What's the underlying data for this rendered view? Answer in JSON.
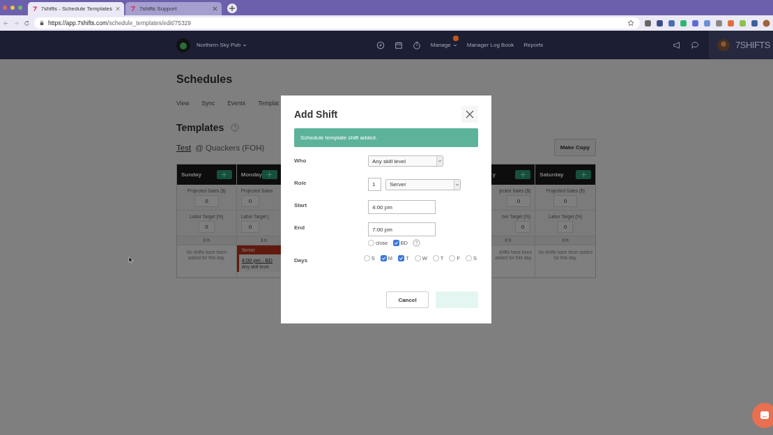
{
  "browser": {
    "tabs": [
      {
        "title": "7shifts - Schedule Templates",
        "selected": true
      },
      {
        "title": "7shifts Support",
        "selected": false
      }
    ],
    "url_host": "https://app.7shifts.com",
    "url_path": "/schedule_templates/edit/75329"
  },
  "nav": {
    "location": "Northern Sky Pub",
    "manage": "Manage",
    "links": [
      "Manager Log Book",
      "Reports"
    ],
    "brand": "7SHIFTS"
  },
  "page": {
    "title": "Schedules",
    "tabs": [
      "View",
      "Sync",
      "Events",
      "Templat"
    ],
    "section": "Templates",
    "template_name": "Test",
    "template_location": "@ Quackers (FOH)",
    "copy_button": "Make Copy"
  },
  "days": [
    {
      "name": "Sunday",
      "projected_label": "Projected Sales ($)",
      "projected": "0",
      "labor_label": "Labor Target (%)",
      "labor": "0",
      "hours": "0 h",
      "empty_text": "No shifts have been added for this day."
    },
    {
      "name": "Monday",
      "projected_label": "Projected Sales",
      "projected": "0",
      "labor_label": "Labor Target (",
      "labor": "0",
      "hours": "3 h",
      "shift": {
        "role": "Server",
        "time": "4:00 pm - BD",
        "skill": "Any skill level"
      }
    },
    {
      "name": "y",
      "projected_label": "jected Sales ($)",
      "projected": "0",
      "labor_label": "bor Target (%)",
      "labor": "0",
      "hours": "0 h",
      "empty_text": "shifts have been added for this day."
    },
    {
      "name": "Saturday",
      "projected_label": "Projected Sales ($)",
      "projected": "0",
      "labor_label": "Labor Target (%)",
      "labor": "0",
      "hours": "0 h",
      "empty_text": "No shifts have been added for this day."
    }
  ],
  "modal": {
    "title": "Add Shift",
    "alert": "Schedule template shift added.",
    "who_label": "Who",
    "who": "Any skill level",
    "role_label": "Role",
    "role_count": "1",
    "role": "Server",
    "start_label": "Start",
    "start": "4:00 pm",
    "end_label": "End",
    "end": "7:00 pm",
    "end_options": [
      {
        "label": "close",
        "checked": false
      },
      {
        "label": "BD",
        "checked": true
      }
    ],
    "days_label": "Days",
    "days": [
      {
        "label": "S",
        "checked": false
      },
      {
        "label": "M",
        "checked": true
      },
      {
        "label": "T",
        "checked": true
      },
      {
        "label": "W",
        "checked": false
      },
      {
        "label": "T",
        "checked": false
      },
      {
        "label": "F",
        "checked": false
      },
      {
        "label": "S",
        "checked": false
      }
    ],
    "cancel": "Cancel"
  }
}
